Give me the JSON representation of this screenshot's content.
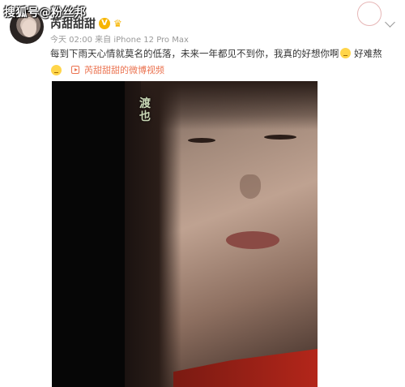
{
  "watermark": "搜狐号@粉丝邦",
  "post": {
    "username": "芮甜甜甜",
    "meta": "今天 02:00 来自 iPhone 12 Pro Max",
    "text_part1": "每到下雨天心情就莫名的低落，未来一年都见不到你，我真的好想你啊",
    "text_part2": "好难熬",
    "video_link": "芮甜甜甜的微博视频"
  },
  "video": {
    "title_overlay": "渡也"
  },
  "colors": {
    "link": "#eb7350",
    "verify": "#f7b500"
  },
  "icons": [
    "avatar",
    "verify-icon",
    "crown-icon",
    "stamp-icon",
    "chevron-down-icon",
    "sad-emoji-icon",
    "play-icon"
  ]
}
